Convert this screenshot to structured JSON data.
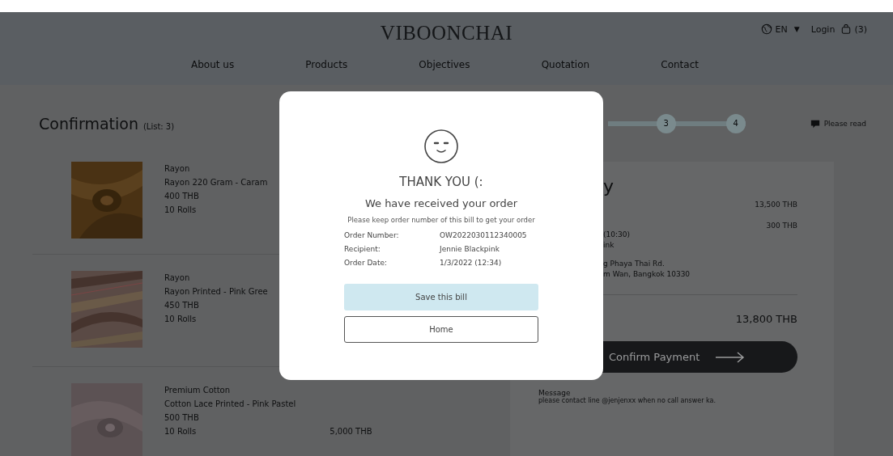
{
  "header": {
    "logo": "VIBOONCHAI",
    "language": "EN",
    "language_caret": "▼",
    "login": "Login",
    "cart_count": "(3)"
  },
  "nav": [
    "About us",
    "Products",
    "Objectives",
    "Quotation",
    "Contact"
  ],
  "page": {
    "title": "Confirmation",
    "list_count": "(List: 3)",
    "steps": [
      "3",
      "4"
    ],
    "note": "Please read"
  },
  "products": [
    {
      "category": "Rayon",
      "name": "Rayon 220 Gram - Caram",
      "price": "400 THB",
      "quantity": "10 Rolls"
    },
    {
      "category": "Rayon",
      "name": "Rayon Printed - Pink Gree",
      "price": "450 THB",
      "quantity": "10 Rolls"
    },
    {
      "category": "Premium Cotton",
      "name": "Cotton Lace Printed - Pink Pastel",
      "price": "500 THB",
      "quantity": "10 Rolls",
      "total": "5,000 THB"
    }
  ],
  "summary": {
    "title_fragment": "y",
    "subtotal": "13,500 THB",
    "shipping": "300 THB",
    "delivery_lines": [
      "(10:30)",
      "ink"
    ],
    "address_lines": [
      "g Phaya Thai Rd.",
      "m Wan, Bangkok 10330"
    ],
    "total": "13,800 THB",
    "confirm_button": "Confirm Payment",
    "message_label": "Message",
    "message": "please contact line @jenjenxx when no call answer ka."
  },
  "modal": {
    "title": "THANK YOU (:",
    "heading": "We have received your order",
    "note": "Please keep order number of this bill to get your order",
    "details": [
      {
        "label": "Order Number:",
        "value": "OW2022030112340005"
      },
      {
        "label": "Recipient:",
        "value": "Jennie Blackpink"
      },
      {
        "label": "Order Date:",
        "value": "1/3/2022 (12:34)"
      }
    ],
    "buttons": [
      {
        "label": "Save this bill",
        "kind": "primary"
      },
      {
        "label": "Home",
        "kind": "outline"
      }
    ]
  }
}
